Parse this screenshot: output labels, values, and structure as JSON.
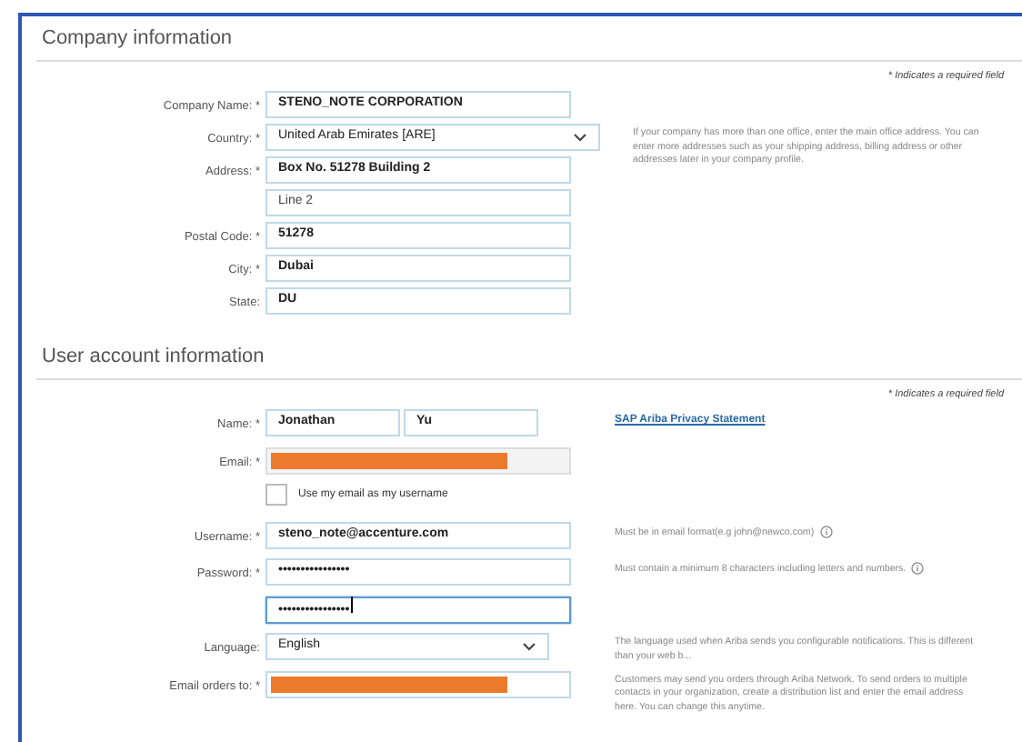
{
  "sections": [
    {
      "title": "Company information",
      "required_note": "* Indicates a required field",
      "rows": [
        {
          "kind": "text",
          "label": "Company Name: *",
          "value": "STENO_NOTE CORPORATION"
        },
        {
          "kind": "select",
          "label": "Country: *",
          "value": "United Arab Emirates  [ARE]",
          "wide": true,
          "help": "If your company has more than one office, enter the main office address. You can enter more addresses such as your shipping address, billing address or other addresses later in your company profile."
        },
        {
          "kind": "text",
          "label": "Address: *",
          "value": "Box No. 51278 Building 2"
        },
        {
          "kind": "text",
          "value": "Line 2",
          "dim": true
        },
        {
          "kind": "text",
          "label": "Postal Code: *",
          "value": "51278"
        },
        {
          "kind": "text",
          "label": "City: *",
          "value": "Dubai"
        },
        {
          "kind": "text",
          "label": "State:",
          "value": "DU"
        }
      ]
    },
    {
      "title": "User account information",
      "required_note": "* Indicates a required field",
      "rows": [
        {
          "kind": "name",
          "label": "Name: *",
          "first": "Jonathan",
          "last": "Yu",
          "link": "SAP Ariba Privacy Statement"
        },
        {
          "kind": "redacted",
          "label": "Email: *",
          "disabled": true
        },
        {
          "kind": "checkbox",
          "text": "Use my email as my username",
          "checked": false
        },
        {
          "kind": "text",
          "label": "Username: *",
          "value": "steno_note@accenture.com",
          "help": "Must be in email format(e.g john@newco.com)",
          "info": true
        },
        {
          "kind": "text",
          "label": "Password: *",
          "value": "••••••••••••••••",
          "help": "Must contain a minimum 8 characters including letters and numbers.",
          "info": true
        },
        {
          "kind": "text",
          "value": "••••••••••••••••",
          "focused": true
        },
        {
          "kind": "select",
          "label": "Language:",
          "value": "English",
          "help": "The language used when Ariba sends you configurable notifications. This is different than your web b..."
        },
        {
          "kind": "redacted",
          "label": "Email orders to: *",
          "disabled": false,
          "help": "Customers may send you orders through Ariba Network. To send orders to multiple contacts in your organization, create a distribution list and enter the email address here. You can change this anytime."
        }
      ]
    }
  ]
}
